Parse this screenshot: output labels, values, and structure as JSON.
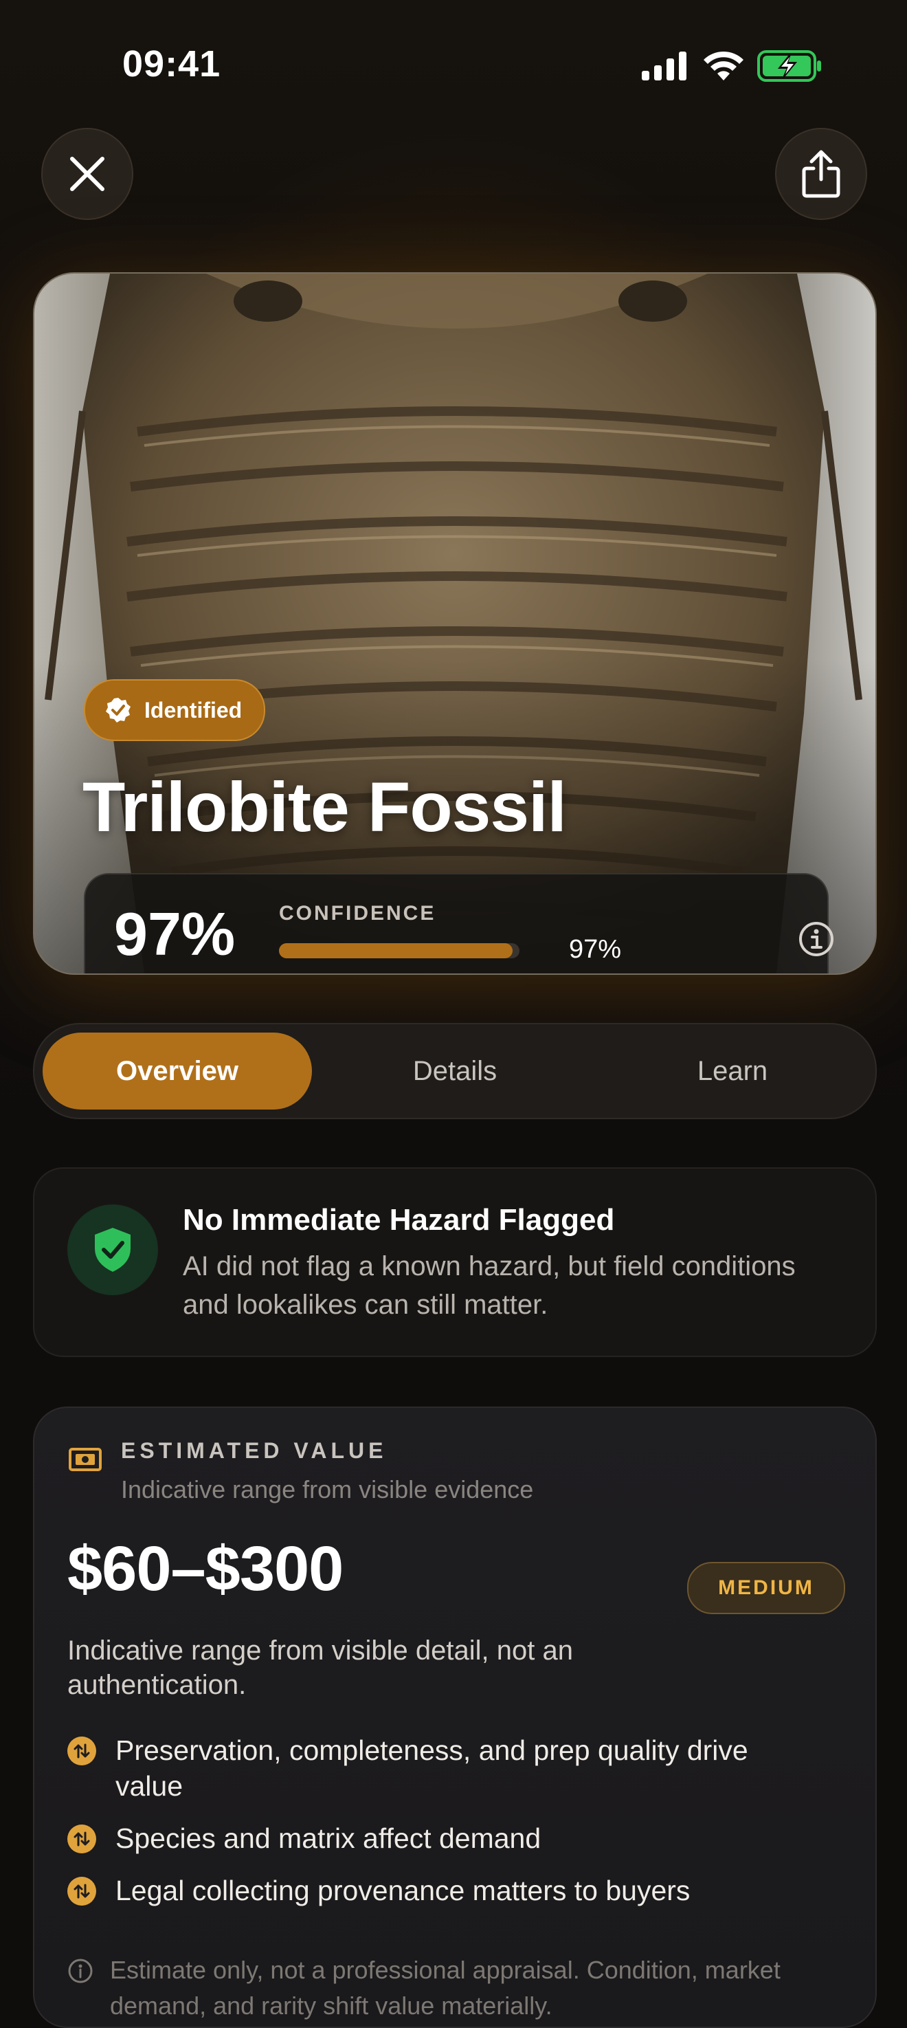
{
  "status_bar": {
    "time": "09:41"
  },
  "hero": {
    "badge": "Identified",
    "title": "Trilobite Fossil",
    "confidence_value": "97%",
    "confidence_label": "CONFIDENCE",
    "confidence_fraction": 0.97,
    "confidence_small": "97%"
  },
  "tabs": [
    {
      "label": "Overview",
      "active": true
    },
    {
      "label": "Details",
      "active": false
    },
    {
      "label": "Learn",
      "active": false
    }
  ],
  "hazard": {
    "title": "No Immediate Hazard Flagged",
    "description": "AI did not flag a known hazard, but field conditions and lookalikes can still matter."
  },
  "value": {
    "label": "ESTIMATED VALUE",
    "subtitle": "Indicative range from visible evidence",
    "price": "$60–$300",
    "level": "MEDIUM",
    "note": "Indicative range from visible detail, not an authentication.",
    "factors": [
      "Preservation, completeness, and prep quality drive value",
      "Species and matrix affect demand",
      "Legal collecting provenance matters to buyers"
    ],
    "disclaimer": "Estimate only, not a professional appraisal. Condition, market demand, and rarity shift value materially."
  },
  "colors": {
    "accent": "#b0701a",
    "safe": "#2fbf5a",
    "badge_gold": "#f0b545"
  }
}
